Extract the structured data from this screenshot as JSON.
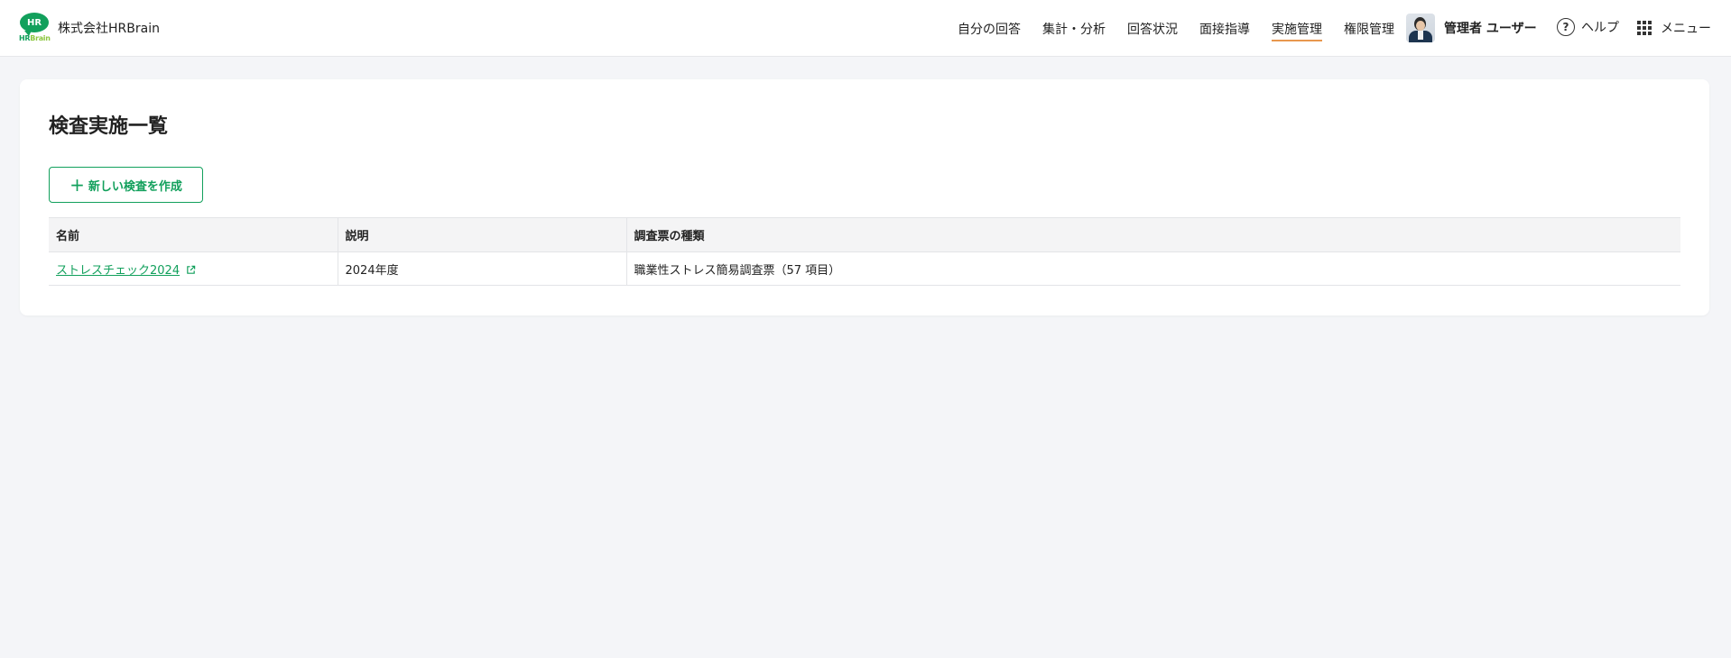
{
  "header": {
    "logo_mark": "HR",
    "logo_word_hr": "HR",
    "logo_word_brain": "Brain",
    "company": "株式会社HRBrain",
    "nav": [
      {
        "label": "自分の回答",
        "active": false
      },
      {
        "label": "集計・分析",
        "active": false
      },
      {
        "label": "回答状況",
        "active": false
      },
      {
        "label": "面接指導",
        "active": false
      },
      {
        "label": "実施管理",
        "active": true
      },
      {
        "label": "権限管理",
        "active": false
      }
    ],
    "user_name": "管理者 ユーザー",
    "help_label": "ヘルプ",
    "help_icon": "question-circle-icon",
    "menu_label": "メニュー",
    "menu_icon": "grid-icon"
  },
  "main": {
    "title": "検査実施一覧",
    "create_button": "新しい検査を作成",
    "table": {
      "headers": [
        "名前",
        "説明",
        "調査票の種類"
      ],
      "rows": [
        {
          "name": "ストレスチェック2024",
          "description": "2024年度",
          "type": "職業性ストレス簡易調査票（57 項目）"
        }
      ]
    }
  },
  "colors": {
    "brand_green": "#12a05c",
    "active_underline": "#e8974e",
    "background": "#f4f5f8"
  }
}
